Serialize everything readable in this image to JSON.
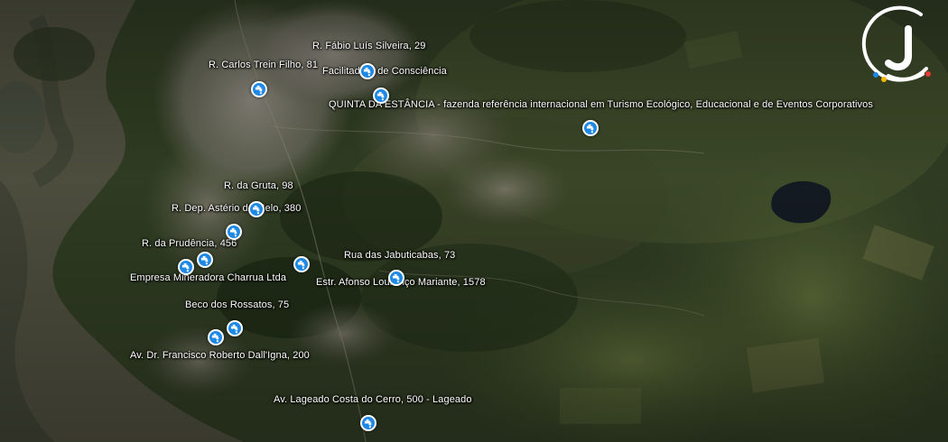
{
  "map": {
    "labels": [
      {
        "text": "R. Fábio Luís Silveira, 29"
      },
      {
        "text": "R. Carlos Trein Filho, 81"
      },
      {
        "text": "Facilitadora de Consciência"
      },
      {
        "text": "QUINTA DA ESTÂNCIA - fazenda referência internacional em Turismo Ecológico, Educacional e de Eventos Corporativos"
      },
      {
        "text": "R. da Gruta, 98"
      },
      {
        "text": "R. Dep. Astério de Melo, 380"
      },
      {
        "text": "R. da Prudência, 456"
      },
      {
        "text": "Rua das Jabuticabas, 73"
      },
      {
        "text": "Empresa Mineradora Charrua Ltda"
      },
      {
        "text": "Estr. Afonso Lourenço Mariante, 1578"
      },
      {
        "text": "Beco dos Rossatos, 75"
      },
      {
        "text": "Av. Dr. Francisco Roberto Dall'Igna, 200"
      },
      {
        "text": "Av. Lageado Costa do Cerro, 500 - Lageado"
      }
    ],
    "markers": [
      {
        "icon": "water-tap-icon"
      },
      {
        "icon": "water-tap-icon"
      },
      {
        "icon": "water-tap-icon"
      },
      {
        "icon": "water-tap-icon"
      },
      {
        "icon": "water-tap-icon"
      },
      {
        "icon": "water-tap-icon"
      },
      {
        "icon": "water-tap-icon"
      },
      {
        "icon": "water-tap-icon"
      },
      {
        "icon": "water-tap-icon"
      },
      {
        "icon": "water-tap-icon"
      },
      {
        "icon": "water-tap-icon"
      },
      {
        "icon": "water-tap-icon"
      },
      {
        "icon": "water-tap-icon"
      },
      {
        "icon": "water-tap-icon"
      }
    ],
    "marker_color": "#1e88e5"
  },
  "logo": {
    "letter": "J",
    "dot_colors": [
      "#1e88e5",
      "#f5b800",
      "#e53935"
    ]
  }
}
